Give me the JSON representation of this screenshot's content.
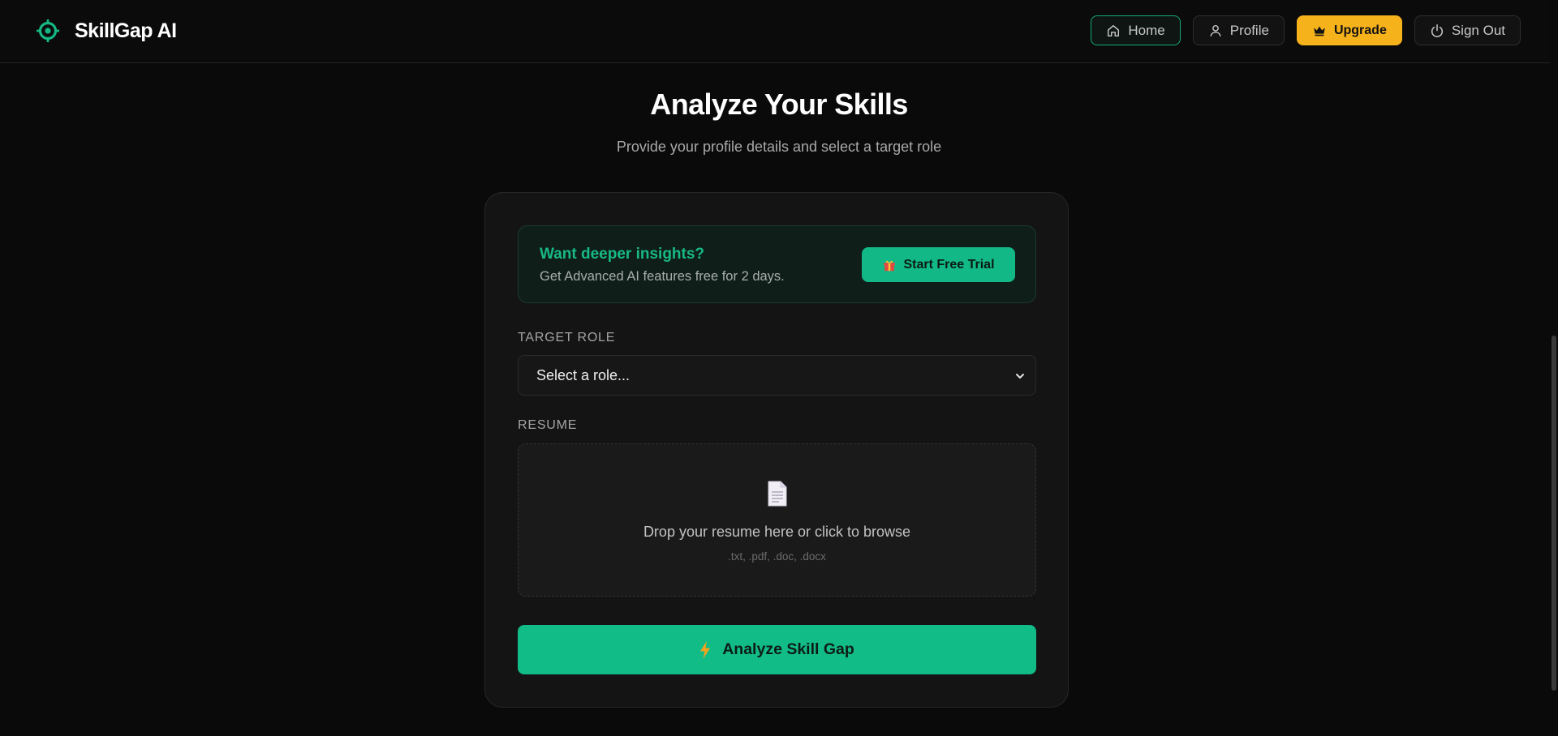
{
  "app": {
    "name": "SkillGap AI"
  },
  "nav": {
    "home": "Home",
    "profile": "Profile",
    "upgrade": "Upgrade",
    "sign_out": "Sign Out"
  },
  "page": {
    "title": "Analyze Your Skills",
    "subtitle": "Provide your profile details and select a target role"
  },
  "promo": {
    "title": "Want deeper insights?",
    "text": "Get Advanced AI features free for 2 days.",
    "button": "Start Free Trial"
  },
  "form": {
    "target_role_label": "TARGET ROLE",
    "target_role_value": "Select a role...",
    "resume_label": "RESUME",
    "drop_text": "Drop your resume here or click to browse",
    "drop_hint": ".txt, .pdf, .doc, .docx",
    "submit": "Analyze Skill Gap"
  },
  "colors": {
    "accent": "#12bc86",
    "upgrade": "#f6b21b",
    "background": "#0a0a0a",
    "card": "#141414"
  },
  "icons": {
    "brand": "target-icon",
    "home": "home-icon",
    "profile": "user-icon",
    "upgrade": "crown-icon",
    "sign_out": "power-icon",
    "trial": "gift-icon",
    "select": "chevron-down-icon",
    "resume": "document-icon",
    "analyze": "lightning-icon"
  }
}
